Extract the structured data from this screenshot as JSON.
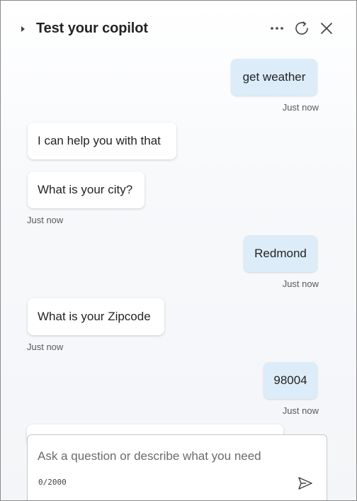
{
  "header": {
    "title": "Test your copilot",
    "icons": {
      "expand": "caret-right-icon",
      "more": "more-horizontal-icon",
      "refresh": "refresh-icon",
      "close": "close-icon"
    }
  },
  "messages": [
    {
      "role": "user",
      "text": "get weather",
      "timestamp": "Just now"
    },
    {
      "role": "bot",
      "text": "I can help you with that"
    },
    {
      "role": "bot",
      "text": "What is your city?",
      "timestamp": "Just now"
    },
    {
      "role": "user",
      "text": "Redmond",
      "timestamp": "Just now"
    },
    {
      "role": "bot",
      "text": "What is your Zipcode",
      "timestamp": "Just now"
    },
    {
      "role": "user",
      "text": "98004",
      "timestamp": "Just now"
    }
  ],
  "composer": {
    "placeholder": "Ask a question or describe what you need",
    "value": "",
    "counter": "0/2000",
    "send_icon": "send-icon"
  },
  "colors": {
    "user_bubble": "#dcecf8",
    "bot_bubble": "#ffffff",
    "title_text": "#242424"
  }
}
